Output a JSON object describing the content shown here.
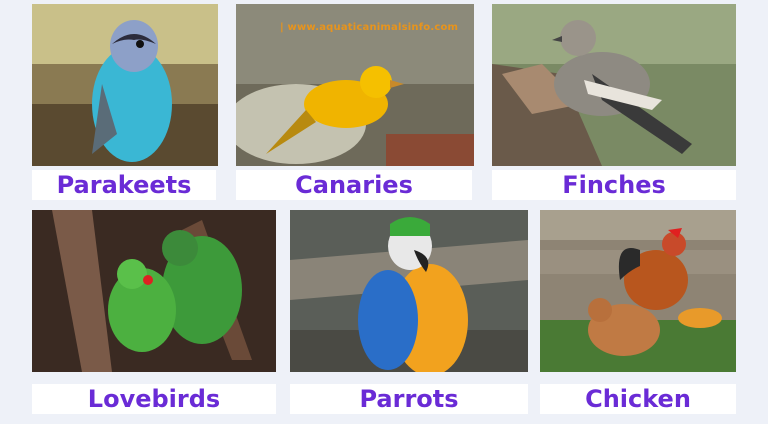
{
  "watermark": "|  www.aquaticanimalsinfo.com",
  "accent_color": "#6a2bd6",
  "tiles": [
    {
      "label": "Parakeets",
      "bird": "budgerigar"
    },
    {
      "label": "Canaries",
      "bird": "canary"
    },
    {
      "label": "Finches",
      "bird": "finch"
    },
    {
      "label": "Lovebirds",
      "bird": "lovebirds"
    },
    {
      "label": "Parrots",
      "bird": "macaw"
    },
    {
      "label": "Chicken",
      "bird": "chicken"
    }
  ]
}
